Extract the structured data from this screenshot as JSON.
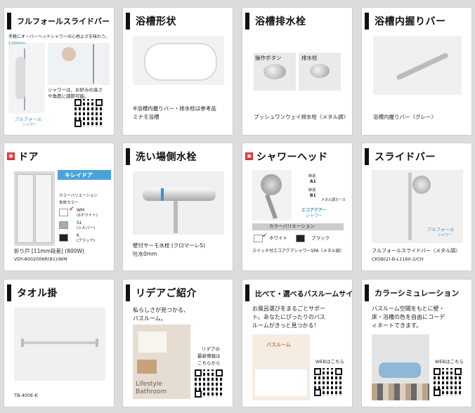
{
  "cards": {
    "c1": {
      "title": "フルフォールスライドバー",
      "line1": "手軽にオーバーヘッドシャワーの心地よさを味わう。",
      "measure": "1,000mm",
      "note1": "シャワーは、お好みの高さ",
      "note2": "や角度に調節可能。",
      "logo1": "フルフォール",
      "logo2": "シャワー"
    },
    "c2": {
      "title": "浴槽形状",
      "note1": "※浴槽内握りバー・排水栓は参考品",
      "note2": "ミナモ浴槽"
    },
    "c3": {
      "title": "浴槽排水栓",
      "label_a": "操作ボタン",
      "label_b": "排水栓",
      "caption": "プッシュワンウェイ排水栓〈メタル調〉"
    },
    "c4": {
      "title": "浴槽内握りバー",
      "caption": "浴槽内握りバー〈グレー〉"
    },
    "c5": {
      "title": "ドア",
      "badge": "キレイドア",
      "cv_title": "カラーバリエーション",
      "body_color": "本体カラー",
      "opt1": "WM",
      "opt1b": "(Sホワイト)",
      "opt2": "S1",
      "opt2b": "(シルバー)",
      "opt3": "K",
      "opt3b": "(ブラック)",
      "caption": "折り戸 [11mm段差] (800W)",
      "code": "VDY-8002006R(81)/WM"
    },
    "c6": {
      "title": "洗い場側水栓",
      "caption1": "壁付サーモ水栓 (クロマーレS)",
      "caption2": "吐水0mm"
    },
    "c7": {
      "title": "シャワーヘッド",
      "tag1a": "節湯",
      "tag1b": "A1",
      "tag2a": "節湯",
      "tag2b": "B1",
      "hose": "メタル調ホース",
      "eco1": "エコアクアー",
      "eco2": "シャワー",
      "cv_title": "カラーバリエーション",
      "opt1": "ホワイト",
      "opt2": "ブラック",
      "caption": "スイッチ付エコアクアシャワーSPA〈メタル調〉"
    },
    "c8": {
      "title": "スライドバー",
      "logo1": "フルフォール",
      "logo2": "シャワー",
      "caption": "フルフォールスライドバー〈メタル調〉",
      "code": "CKSB(2)-B-L1160-2/CH"
    },
    "c9": {
      "title": "タオル掛",
      "code": "TB-400E-K"
    },
    "c10": {
      "title": "リデアご紹介",
      "line1": "私らしさが見つかる、",
      "line2": "バスルーム。",
      "qr1": "リデアの",
      "qr2": "最新情報は",
      "qr3": "こちらから",
      "brand1": "Lifestyle",
      "brand2": "Bathroom"
    },
    "c11": {
      "title": "比べて・選べるバスルームサイト",
      "line1": "お風呂選びをまるごとサポー",
      "line2": "ト。あなたにぴったりのバス",
      "line3": "ルームがきっと見つかる！",
      "web": "WEBはこちら",
      "site": "バスルーム"
    },
    "c12": {
      "title": "カラーシミュレーション",
      "line1": "バスルーム空間をもとに壁・",
      "line2": "床・浴槽の色を自由にコーデ",
      "line3": "ィネートできます。",
      "web": "WEBはこちら"
    }
  }
}
